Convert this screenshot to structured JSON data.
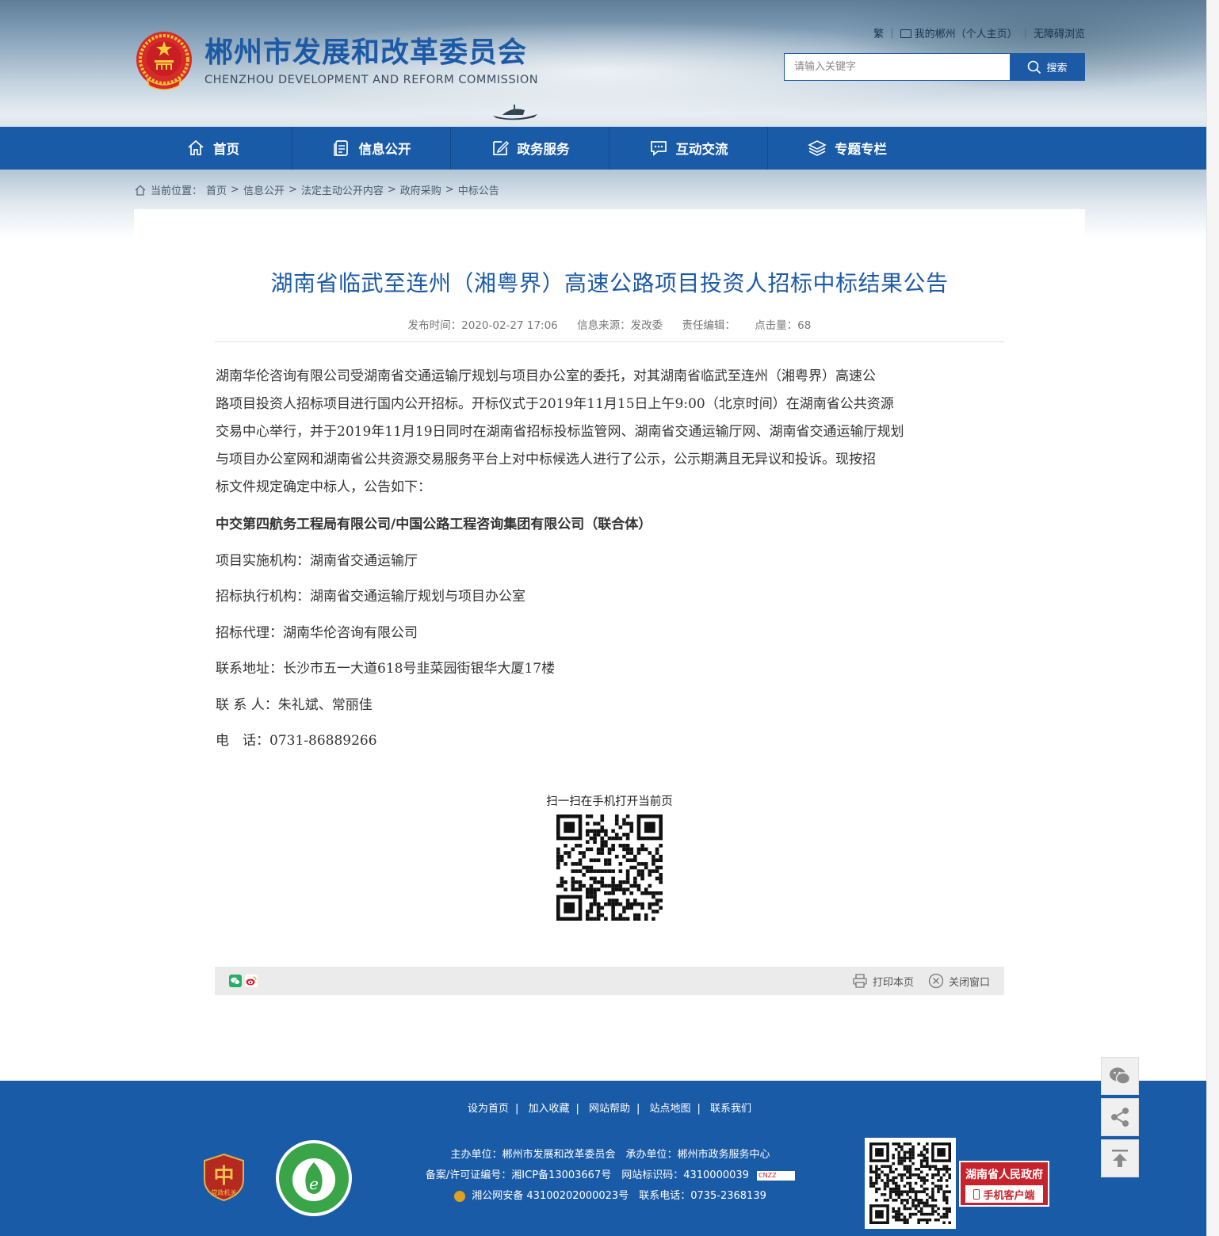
{
  "header": {
    "title": "郴州市发展和改革委员会",
    "subtitle": "CHENZHOU DEVELOPMENT AND REFORM COMMISSION",
    "top_links": [
      "繁",
      "我的郴州（个人主页）",
      "无障碍浏览"
    ],
    "search_placeholder": "请输入关键字",
    "search_button": "搜索"
  },
  "nav": [
    {
      "label": "首页",
      "icon": "home-icon"
    },
    {
      "label": "信息公开",
      "icon": "document-icon"
    },
    {
      "label": "政务服务",
      "icon": "edit-icon"
    },
    {
      "label": "互动交流",
      "icon": "chat-icon"
    },
    {
      "label": "专题专栏",
      "icon": "layers-icon"
    }
  ],
  "breadcrumb": {
    "prefix": "当前位置：",
    "items": [
      "首页",
      "信息公开",
      "法定主动公开内容",
      "政府采购",
      "中标公告"
    ],
    "separator": ">"
  },
  "article": {
    "title": "湖南省临武至连州（湘粤界）高速公路项目投资人招标中标结果公告",
    "meta": {
      "publish": "发布时间：2020-02-27 17:06",
      "source": "信息来源：发改委",
      "editor": "责任编辑：",
      "views": "点击量：68"
    },
    "intro_lines": [
      "湖南华伦咨询有限公司受湖南省交通运输厅规划与项目办公室的委托，对其湖南省临武至连州（湘粤界）高速公",
      "路项目投资人招标项目进行国内公开招标。开标仪式于2019年11月15日上午9:00（北京时间）在湖南省公共资源",
      "交易中心举行，并于2019年11月19日同时在湖南省招标投标监管网、湖南省交通运输厅网、湖南省交通运输厅规划",
      "与项目办公室网和湖南省公共资源交易服务平台上对中标候选人进行了公示，公示期满且无异议和投诉。现按招",
      "标文件规定确定中标人，公告如下："
    ],
    "winner": "中交第四航务工程局有限公司/中国公路工程咨询集团有限公司（联合体）",
    "details": [
      "项目实施机构：湖南省交通运输厅",
      "招标执行机构：湖南省交通运输厅规划与项目办公室",
      "招标代理：湖南华伦咨询有限公司",
      "联系地址：长沙市五一大道618号韭菜园街银华大厦17楼",
      "联 系 人：朱礼斌、常丽佳",
      "电　话：0731-86889266"
    ],
    "qr_caption": "扫一扫在手机打开当前页",
    "print": "打印本页",
    "close": "关闭窗口"
  },
  "footer": {
    "links": [
      "设为首页",
      "加入收藏",
      "网站帮助",
      "站点地图",
      "联系我们"
    ],
    "line1": "主办单位：郴州市发展和改革委员会　承办单位：郴州市政务服务中心",
    "line2": "备案/许可证编号：湘ICP备13003667号　网站标识码：4310000039",
    "line3": "湘公网安备 43100202000023号　联系电话：0735-2368139",
    "badge_text": "党政机关",
    "app_title": "湖南省人民政府",
    "app_sub": "手机客户端",
    "cnzz": "CNZZ"
  },
  "colors": {
    "primary": "#1a5ba8",
    "title_blue": "#1d5aa6",
    "footer_red": "#c8232c"
  }
}
